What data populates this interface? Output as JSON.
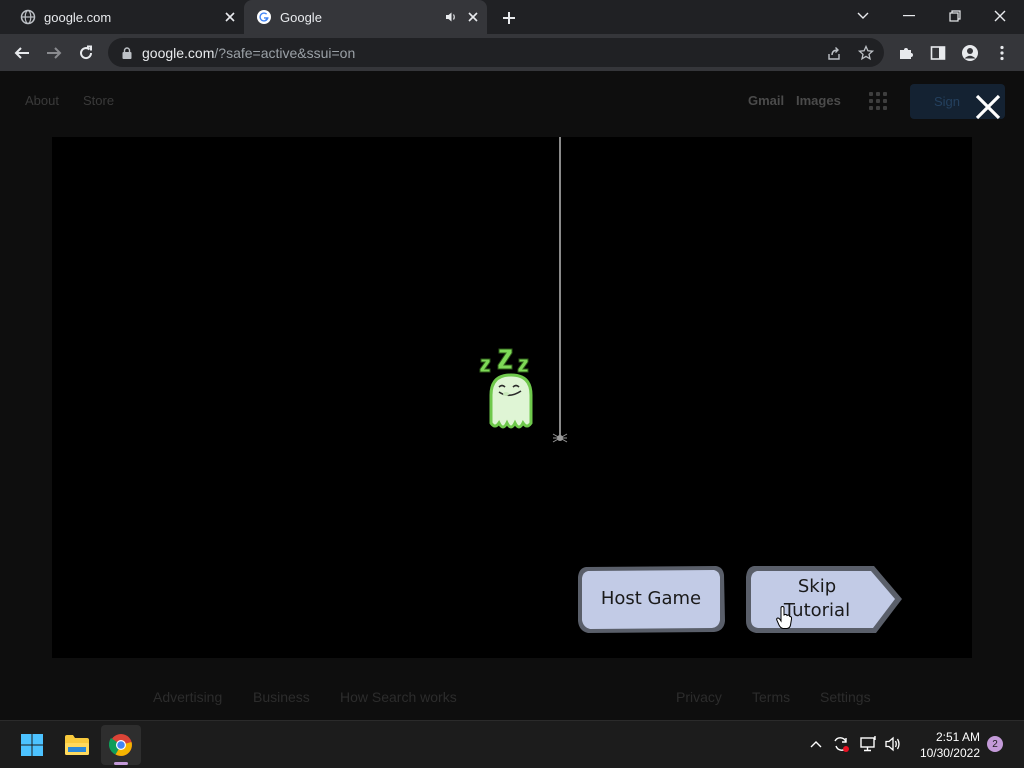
{
  "browser": {
    "tabs": [
      {
        "title": "google.com",
        "active": false
      },
      {
        "title": "Google",
        "active": true
      }
    ],
    "url_host": "google.com",
    "url_path": "/?safe=active&ssui=on"
  },
  "google_page": {
    "header_left": [
      "About",
      "Store"
    ],
    "header_right": [
      "Gmail",
      "Images"
    ],
    "signin_label": "Sign",
    "footer_left": [
      "Advertising",
      "Business",
      "How Search works"
    ],
    "footer_right": [
      "Privacy",
      "Terms",
      "Settings"
    ]
  },
  "game": {
    "host_button": "Host Game",
    "skip_button_line1": "Skip",
    "skip_button_line2": "Tutorial",
    "sleep_text": "zZz"
  },
  "taskbar": {
    "time": "2:51 AM",
    "date": "10/30/2022",
    "notifications": "2"
  },
  "colors": {
    "tab_bar": "#202124",
    "toolbar": "#35363a",
    "game_bg": "#000000",
    "button_fill": "#c2cbe6",
    "ghost_green": "#7ed957"
  }
}
